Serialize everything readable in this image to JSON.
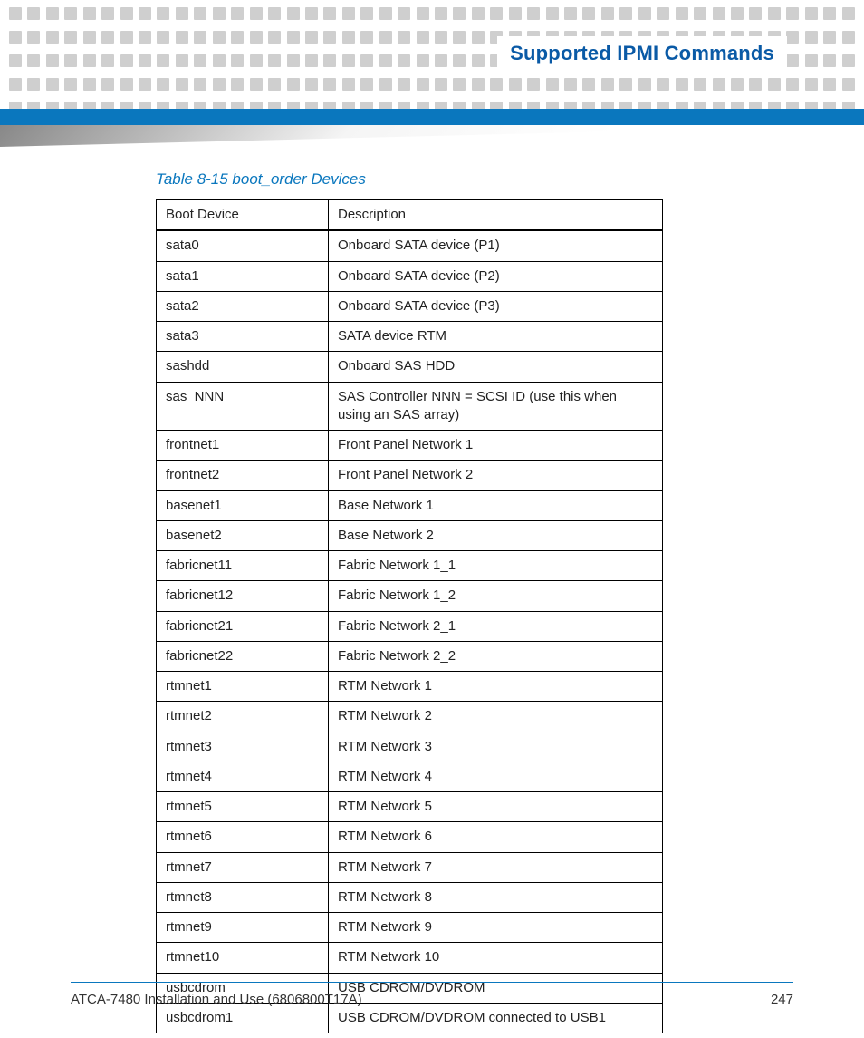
{
  "header": {
    "title": "Supported IPMI Commands"
  },
  "table": {
    "caption": "Table 8-15 boot_order Devices",
    "headers": [
      "Boot Device",
      "Description"
    ],
    "rows": [
      [
        "sata0",
        "Onboard SATA device (P1)"
      ],
      [
        "sata1",
        "Onboard SATA device (P2)"
      ],
      [
        "sata2",
        "Onboard SATA device (P3)"
      ],
      [
        "sata3",
        "SATA device RTM"
      ],
      [
        "sashdd",
        "Onboard SAS HDD"
      ],
      [
        "sas_NNN",
        "SAS Controller NNN = SCSI ID (use this when using an SAS array)"
      ],
      [
        "frontnet1",
        "Front Panel Network 1"
      ],
      [
        "frontnet2",
        "Front Panel Network 2"
      ],
      [
        "basenet1",
        "Base Network 1"
      ],
      [
        "basenet2",
        "Base Network 2"
      ],
      [
        "fabricnet11",
        "Fabric Network 1_1"
      ],
      [
        "fabricnet12",
        "Fabric Network 1_2"
      ],
      [
        "fabricnet21",
        "Fabric Network 2_1"
      ],
      [
        "fabricnet22",
        "Fabric Network 2_2"
      ],
      [
        "rtmnet1",
        "RTM Network 1"
      ],
      [
        "rtmnet2",
        "RTM Network 2"
      ],
      [
        "rtmnet3",
        "RTM Network 3"
      ],
      [
        "rtmnet4",
        "RTM Network 4"
      ],
      [
        "rtmnet5",
        "RTM Network 5"
      ],
      [
        "rtmnet6",
        "RTM Network 6"
      ],
      [
        "rtmnet7",
        "RTM Network 7"
      ],
      [
        "rtmnet8",
        "RTM Network 8"
      ],
      [
        "rtmnet9",
        "RTM Network 9"
      ],
      [
        "rtmnet10",
        "RTM Network 10"
      ],
      [
        "usbcdrom",
        "USB CDROM/DVDROM"
      ],
      [
        "usbcdrom1",
        "USB CDROM/DVDROM connected to USB1"
      ]
    ]
  },
  "footer": {
    "doc_title": "ATCA-7480 Installation and Use (6806800T17A)",
    "page_number": "247"
  }
}
